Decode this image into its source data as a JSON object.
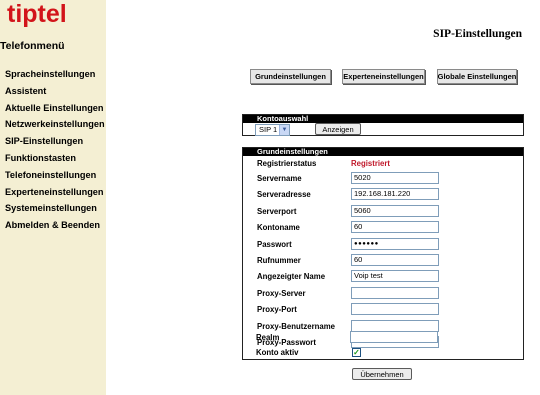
{
  "brand": {
    "logo_text": "tiptel",
    "color": "#d2141a"
  },
  "sidebar": {
    "title": "Telefonmenü",
    "items": [
      {
        "label": "Spracheinstellungen"
      },
      {
        "label": "Assistent"
      },
      {
        "label": "Aktuelle Einstellungen"
      },
      {
        "label": "Netzwerkeinstellungen"
      },
      {
        "label": "SIP-Einstellungen"
      },
      {
        "label": "Funktionstasten"
      },
      {
        "label": "Telefoneinstellungen"
      },
      {
        "label": "Experteneinstellungen"
      },
      {
        "label": "Systemeinstellungen"
      },
      {
        "label": "Abmelden & Beenden"
      }
    ]
  },
  "page_title": "SIP-Einstellungen",
  "tabs": {
    "basic": "Grundeinstellungen",
    "expert": "Experteneinstellungen",
    "global": "Globale Einstellungen"
  },
  "account_select": {
    "header": "Kontoauswahl",
    "selected": "SIP 1",
    "show_button": "Anzeigen"
  },
  "basic_settings": {
    "header": "Grundeinstellungen",
    "registration_label": "Registrierstatus",
    "registration_value": "Registriert",
    "fields": {
      "servername": {
        "label": "Servername",
        "value": "5020"
      },
      "serveraddress": {
        "label": "Serveradresse",
        "value": "192.168.181.220"
      },
      "serverport": {
        "label": "Serverport",
        "value": "5060"
      },
      "accountname": {
        "label": "Kontoname",
        "value": "60"
      },
      "password": {
        "label": "Passwort",
        "value": "●●●●●●"
      },
      "number": {
        "label": "Rufnummer",
        "value": "60"
      },
      "displayname": {
        "label": "Angezeigter Name",
        "value": "Voip test"
      },
      "proxyserver": {
        "label": "Proxy-Server",
        "value": ""
      },
      "proxyport": {
        "label": "Proxy-Port",
        "value": ""
      },
      "proxyuser": {
        "label": "Proxy-Benutzername",
        "value": ""
      },
      "proxypass": {
        "label": "Proxy-Passwort",
        "value": ""
      },
      "realm": {
        "label": "Realm",
        "value": ""
      }
    },
    "active_label": "Konto aktiv",
    "active_checked": true,
    "submit": "Übernehmen"
  }
}
